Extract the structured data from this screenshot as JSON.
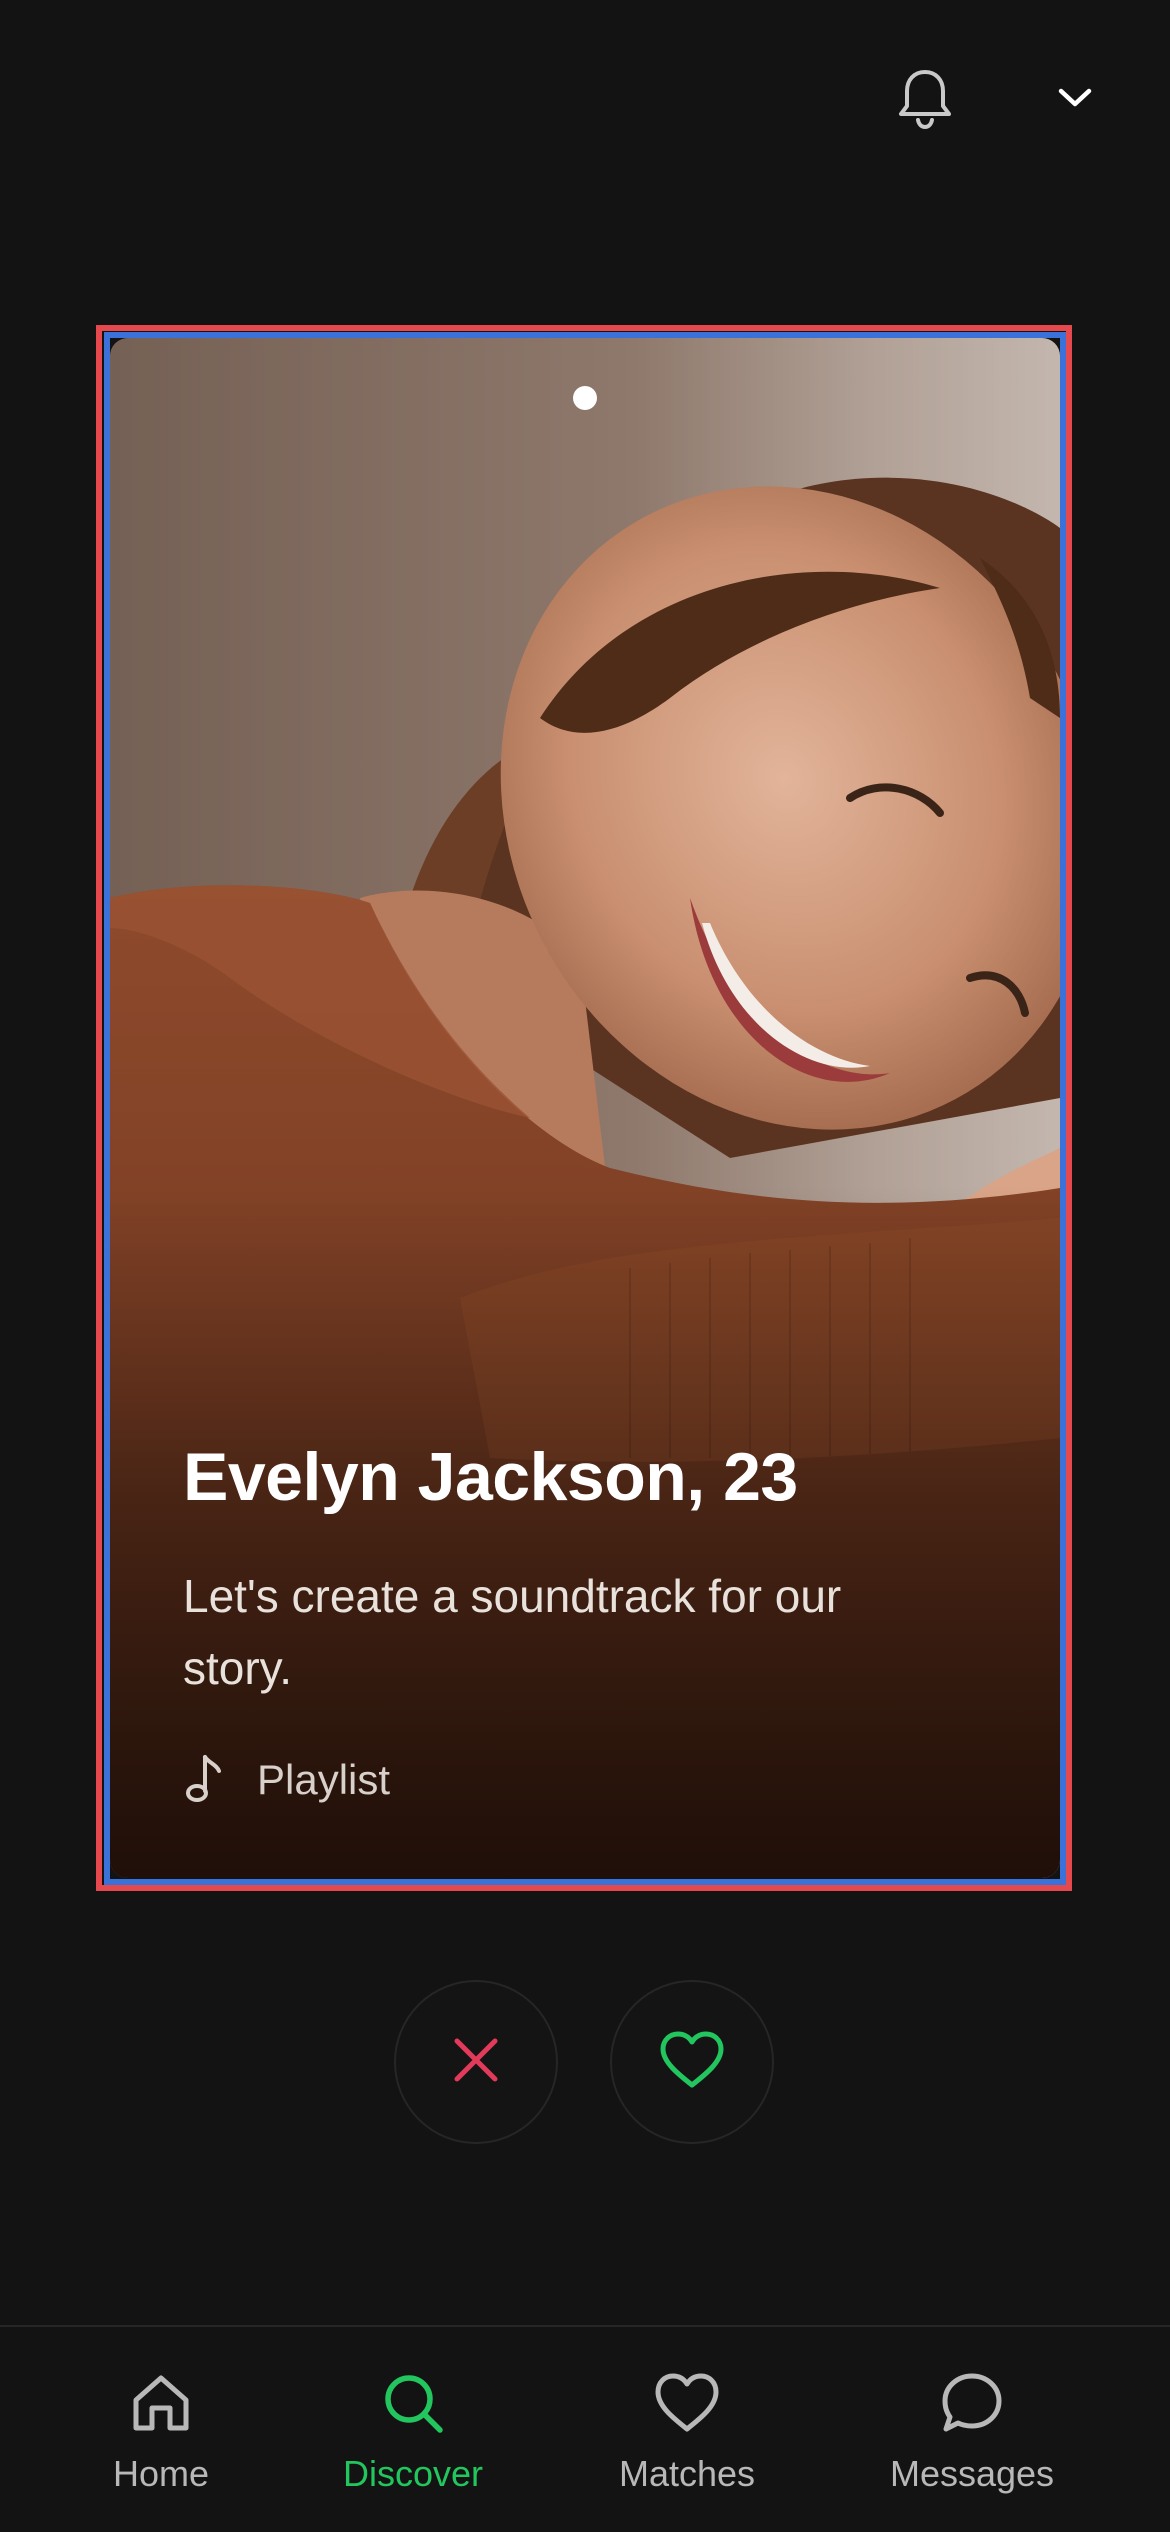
{
  "header": {
    "notifications_icon": "bell-icon",
    "menu_icon": "chevron-down-icon"
  },
  "profile": {
    "name": "Evelyn Jackson, 23",
    "bio": "Let's create a soundtrack for our story.",
    "playlist_label": "Playlist",
    "playlist_icon": "music-note-icon",
    "photo_count": 1,
    "current_photo": 1
  },
  "actions": {
    "dislike_icon": "close-icon",
    "like_icon": "heart-icon",
    "dislike_color": "#e23a5a",
    "like_color": "#22c55e"
  },
  "nav": {
    "items": [
      {
        "label": "Home",
        "icon": "home-icon",
        "active": false
      },
      {
        "label": "Discover",
        "icon": "search-icon",
        "active": true
      },
      {
        "label": "Matches",
        "icon": "heart-icon",
        "active": false
      },
      {
        "label": "Messages",
        "icon": "chat-bubble-icon",
        "active": false
      }
    ]
  },
  "colors": {
    "background": "#131313",
    "accent": "#22c55e",
    "selection_outer": "#e5484d",
    "selection_inner": "#3b72d9"
  }
}
